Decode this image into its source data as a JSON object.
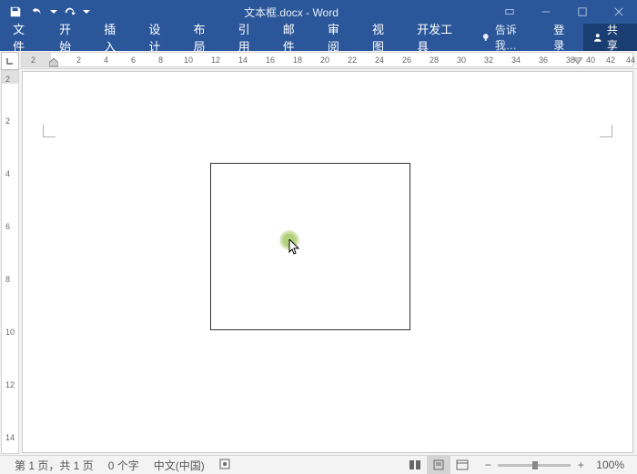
{
  "title": "文本框.docx - Word",
  "qat": {
    "save": "保存",
    "undo": "撤销",
    "redo": "重做",
    "customize": "自定义"
  },
  "tabs": {
    "file": "文件",
    "items": [
      "开始",
      "插入",
      "设计",
      "布局",
      "引用",
      "邮件",
      "审阅",
      "视图",
      "开发工具"
    ],
    "tell_me": "告诉我…",
    "login": "登录",
    "share": "共享"
  },
  "ruler_h": [
    "2",
    "2",
    "4",
    "6",
    "8",
    "10",
    "12",
    "14",
    "16",
    "18",
    "20",
    "22",
    "24",
    "26",
    "28",
    "30",
    "32",
    "34",
    "36",
    "38",
    "40",
    "42",
    "44"
  ],
  "ruler_v": [
    "2",
    "2",
    "4",
    "6",
    "8",
    "10",
    "12",
    "14"
  ],
  "status": {
    "page": "第 1 页，共 1 页",
    "words": "0 个字",
    "lang": "中文(中国)",
    "zoom_pct": "100%"
  }
}
